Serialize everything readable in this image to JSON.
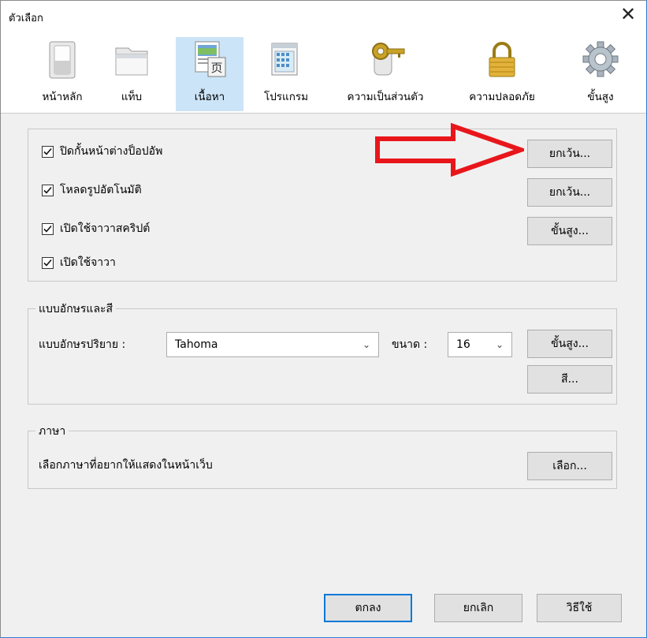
{
  "window": {
    "title": "ตัวเลือก",
    "close_symbol": "✕"
  },
  "tabs": [
    {
      "label": "หน้าหลัก",
      "icon": "switch-icon",
      "selected": false
    },
    {
      "label": "แท็บ",
      "icon": "folder-tab-icon",
      "selected": false
    },
    {
      "label": "เนื้อหา",
      "icon": "content-page-icon",
      "selected": true
    },
    {
      "label": "โปรแกรม",
      "icon": "applications-icon",
      "selected": false
    },
    {
      "label": "ความเป็นส่วนตัว",
      "icon": "privacy-key-icon",
      "selected": false
    },
    {
      "label": "ความปลอดภัย",
      "icon": "padlock-icon",
      "selected": false
    },
    {
      "label": "ขั้นสูง",
      "icon": "gear-icon",
      "selected": false
    }
  ],
  "content": {
    "options": [
      {
        "label": "ปิดกั้นหน้าต่างป็อปอัพ",
        "checked": true,
        "button": "ยกเว้น..."
      },
      {
        "label": "โหลดรูปอัตโนมัติ",
        "checked": true,
        "button": "ยกเว้น..."
      },
      {
        "label": "เปิดใช้จาวาสคริปต์",
        "checked": true,
        "button": "ขั้นสูง..."
      },
      {
        "label": "เปิดใช้จาวา",
        "checked": true,
        "button": ""
      }
    ]
  },
  "fonts": {
    "legend": "แบบอักษรและสี",
    "default_font_label": "แบบอักษรปริยาย :",
    "default_font_value": "Tahoma",
    "size_label": "ขนาด :",
    "size_value": "16",
    "advanced_button": "ขั้นสูง...",
    "colors_button": "สี..."
  },
  "languages": {
    "legend": "ภาษา",
    "description": "เลือกภาษาที่อยากให้แสดงในหน้าเว็บ",
    "choose_button": "เลือก..."
  },
  "footer": {
    "ok": "ตกลง",
    "cancel": "ยกเลิก",
    "help": "วิธีใช้"
  },
  "colors": {
    "accent": "#0078d7",
    "selected_tab": "#cce4f7",
    "annotation_arrow": "#e8161b"
  }
}
